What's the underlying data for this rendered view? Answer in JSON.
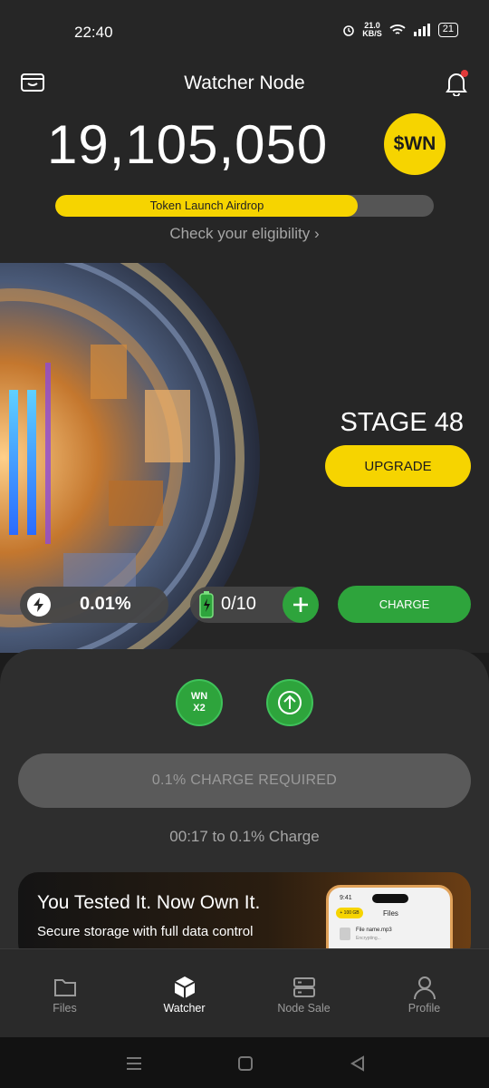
{
  "status_bar": {
    "time": "22:40",
    "speed_value": "21.0",
    "speed_unit": "KB/S",
    "battery": "21"
  },
  "header": {
    "title": "Watcher Node"
  },
  "balance": {
    "amount": "19,105,050",
    "token": "$WN"
  },
  "airdrop": {
    "label": "Token Launch Airdrop",
    "progress_percent": 80,
    "eligibility_link": "Check your eligibility ›"
  },
  "node": {
    "stage": "STAGE 48",
    "upgrade_label": "UPGRADE",
    "rate": "0.01%",
    "charges": "0/10",
    "charge_label": "CHARGE"
  },
  "panel": {
    "boost_wn_line1": "WN",
    "boost_wn_line2": "X2",
    "charge_required_label": "0.1% CHARGE REQUIRED",
    "timer_text": "00:17 to 0.1% Charge"
  },
  "promo": {
    "title": "You Tested It. Now Own It.",
    "subtitle": "Secure storage with full data control",
    "phone_time": "9:41",
    "phone_badge": "+ 100 GB",
    "phone_screen_title": "Files",
    "phone_file_name": "File name.mp3",
    "phone_file_status": "Encrypting..."
  },
  "bottom_nav": {
    "items": [
      {
        "label": "Files",
        "icon": "folder-icon"
      },
      {
        "label": "Watcher",
        "icon": "cube-icon",
        "active": true
      },
      {
        "label": "Node Sale",
        "icon": "server-icon"
      },
      {
        "label": "Profile",
        "icon": "user-icon"
      }
    ]
  },
  "colors": {
    "accent_yellow": "#f6d400",
    "accent_green": "#2ea43c",
    "background": "#262626"
  }
}
